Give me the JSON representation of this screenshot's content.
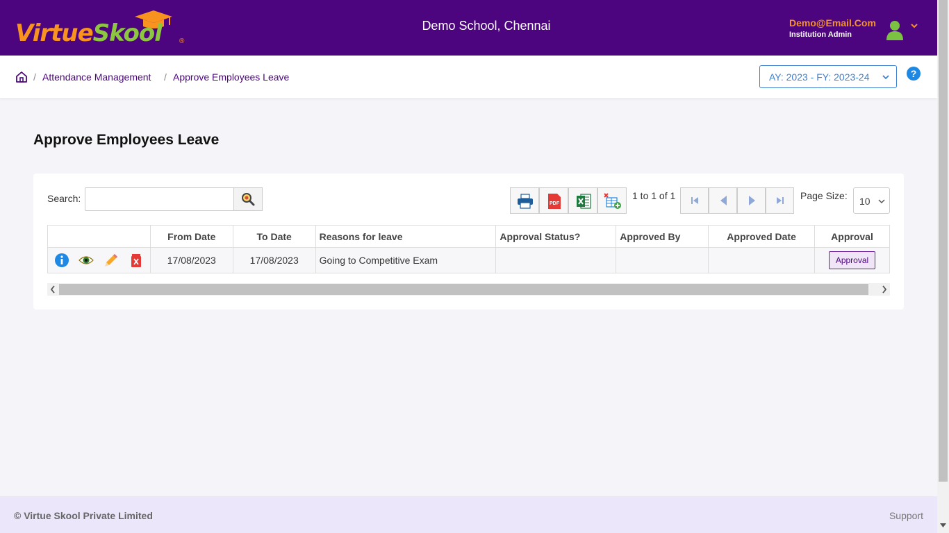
{
  "brand": {
    "logo_part1": "Virtue",
    "logo_part2": "Skool",
    "reg": "®"
  },
  "header": {
    "school_name": "Demo School, Chennai",
    "user_email": "Demo@Email.Com",
    "user_role": "Institution Admin"
  },
  "breadcrumb": {
    "items": [
      "Attendance Management",
      "Approve Employees Leave"
    ],
    "separator": "/"
  },
  "academic_year": {
    "label": "AY: 2023 - FY: 2023-24"
  },
  "help": {
    "label": "?"
  },
  "page": {
    "title": "Approve Employees Leave"
  },
  "toolbar": {
    "search_label": "Search:",
    "search_value": "",
    "search_icon": "magnifier-icon",
    "export_buttons": [
      "print-icon",
      "pdf-icon",
      "excel-icon",
      "add-table-icon"
    ],
    "pdf_text": "PDF"
  },
  "pager": {
    "summary": "1 to 1 of 1",
    "page_size_label": "Page Size:",
    "page_size": "10"
  },
  "table": {
    "columns": [
      "",
      "From Date",
      "To Date",
      "Reasons for leave",
      "Approval Status?",
      "Approved By",
      "Approved Date",
      "Approval"
    ],
    "rows": [
      {
        "actions": [
          "info-icon",
          "view-icon",
          "edit-icon",
          "delete-icon"
        ],
        "from_date": "17/08/2023",
        "to_date": "17/08/2023",
        "reason": "Going to Competitive Exam",
        "approval_status": "",
        "approved_by": "",
        "approved_date": "",
        "approval_button": "Approval"
      }
    ]
  },
  "footer": {
    "copyright": "© Virtue Skool Private Limited",
    "support": "Support"
  },
  "colors": {
    "brand_purple": "#4d057f",
    "brand_orange": "#f7931e",
    "brand_green": "#8dc63f",
    "link_blue": "#3d7fcf"
  }
}
